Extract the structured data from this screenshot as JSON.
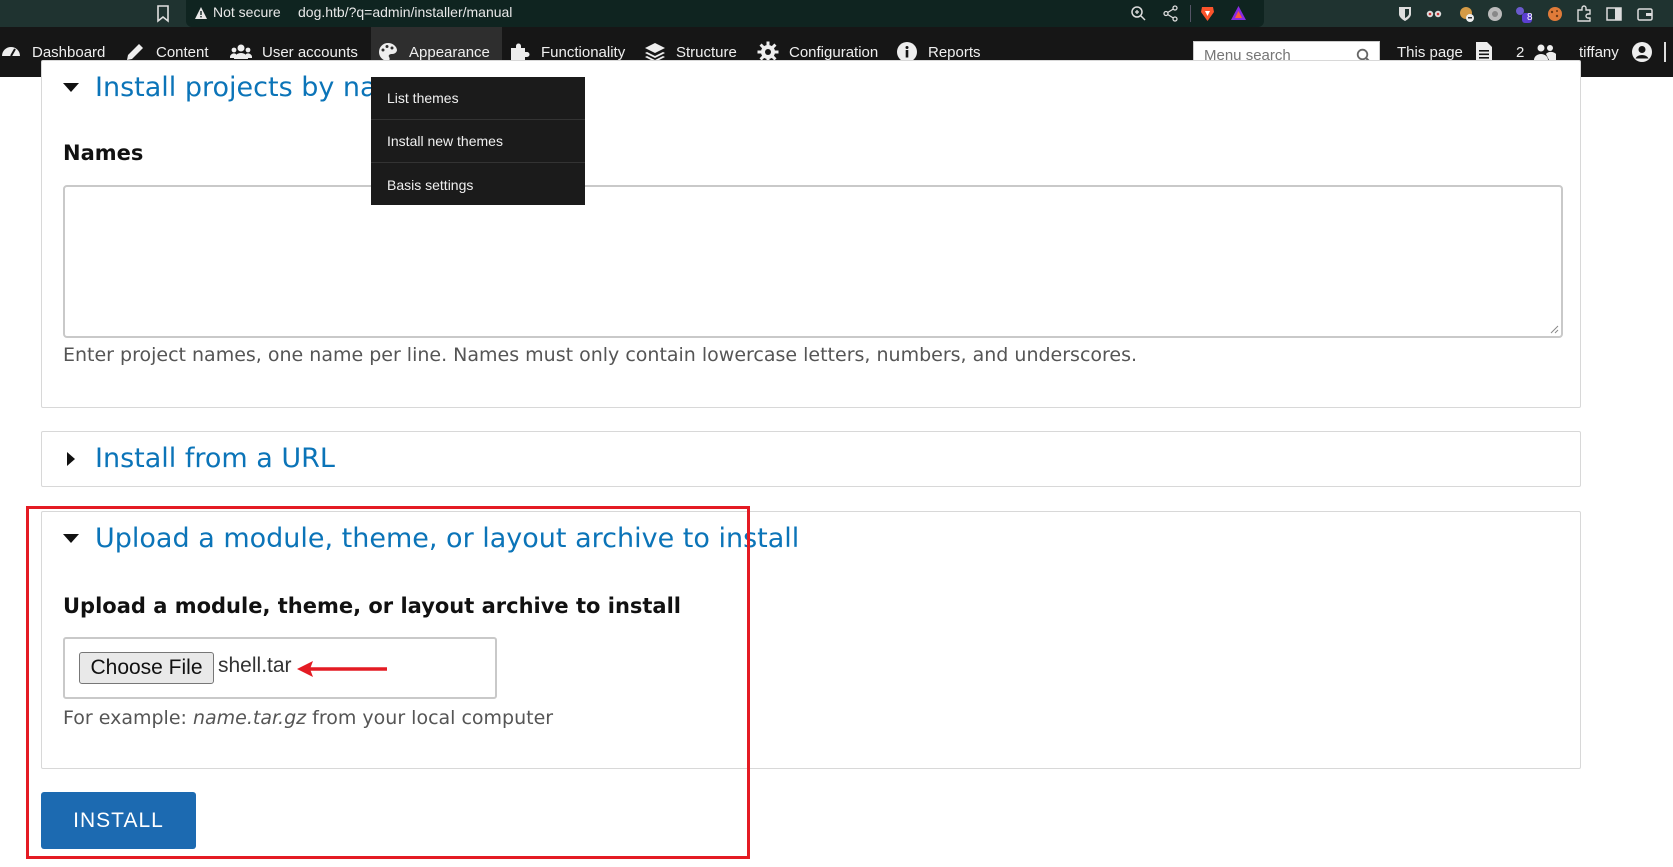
{
  "browser": {
    "not_secure_label": "Not secure",
    "url": "dog.htb/?q=admin/installer/manual",
    "extensions_badge": "8"
  },
  "toolbar": {
    "items": [
      {
        "label": "Dashboard",
        "icon": "dashboard-icon"
      },
      {
        "label": "Content",
        "icon": "pencil-icon"
      },
      {
        "label": "User accounts",
        "icon": "users-icon"
      },
      {
        "label": "Appearance",
        "icon": "palette-icon",
        "active": true
      },
      {
        "label": "Functionality",
        "icon": "puzzle-icon"
      },
      {
        "label": "Structure",
        "icon": "layers-icon"
      },
      {
        "label": "Configuration",
        "icon": "gear-icon"
      },
      {
        "label": "Reports",
        "icon": "info-icon"
      }
    ],
    "search_placeholder": "Menu search",
    "this_page_label": "This page",
    "user_count": "2",
    "username": "tiffany"
  },
  "dropdown": {
    "items": [
      "List themes",
      "Install new themes",
      "Basis settings"
    ]
  },
  "main": {
    "section_names": {
      "legend": "Install projects by name",
      "label": "Names",
      "help": "Enter project names, one name per line. Names must only contain lowercase letters, numbers, and underscores."
    },
    "section_url": {
      "legend": "Install from a URL"
    },
    "section_upload": {
      "legend": "Upload a module, theme, or layout archive to install",
      "label": "Upload a module, theme, or layout archive to install",
      "choose_file_label": "Choose File",
      "file_name": "shell.tar",
      "help_prefix": "For example: ",
      "help_example": "name.tar.gz",
      "help_suffix": " from your local computer"
    },
    "install_label": "INSTALL"
  },
  "colors": {
    "toolbar_bg": "#161616",
    "link_blue": "#0b74b8",
    "install_button": "#1c6ab1",
    "annotation_red": "#e41b23"
  }
}
